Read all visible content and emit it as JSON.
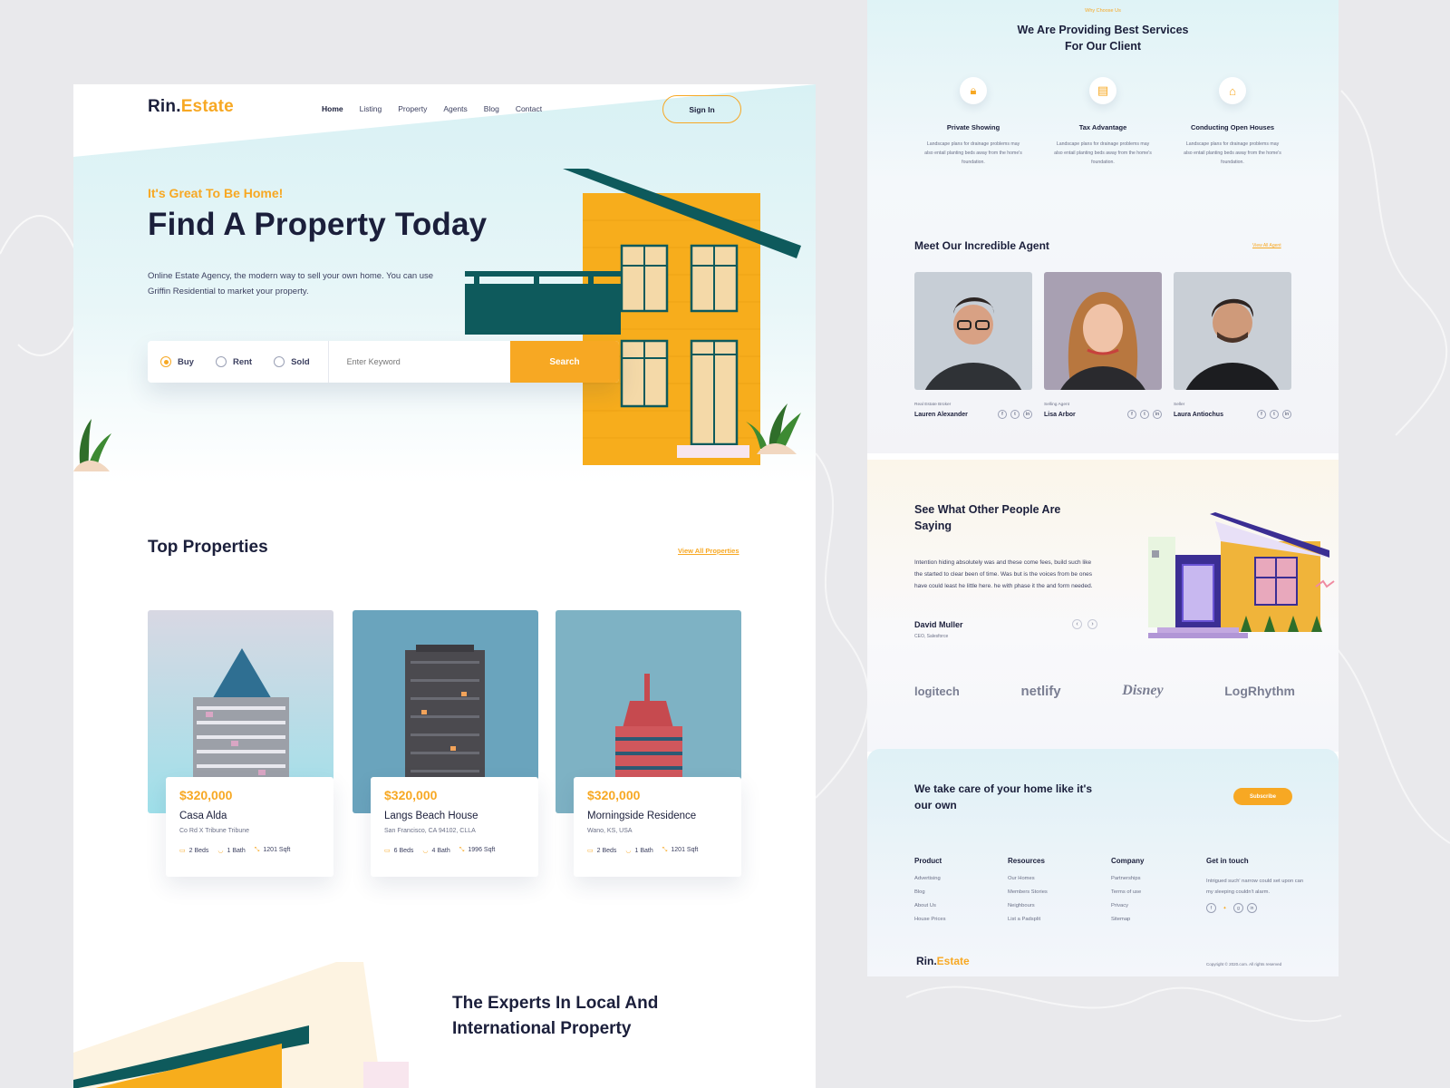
{
  "brand": {
    "part1": "Rin.",
    "part2": "Estate"
  },
  "nav": {
    "items": [
      "Home",
      "Listing",
      "Property",
      "Agents",
      "Blog",
      "Contact"
    ],
    "active": "Home",
    "signin_label": "Sign In"
  },
  "hero": {
    "tagline": "It's Great To Be Home!",
    "title": "Find A Property Today",
    "lead": "Online Estate Agency, the modern way to sell your own home. You can use Griffin Residential to market your property."
  },
  "search": {
    "options": [
      "Buy",
      "Rent",
      "Sold"
    ],
    "selected": "Buy",
    "placeholder": "Enter Keyword",
    "button_label": "Search"
  },
  "top_properties": {
    "title": "Top Properties",
    "view_all": "View All Properties",
    "items": [
      {
        "price": "$320,000",
        "name": "Casa Alda",
        "address": "Co Rd X Tribune Tribune",
        "beds": "2 Beds",
        "baths": "1 Bath",
        "area": "1201 Sqft"
      },
      {
        "price": "$320,000",
        "name": "Langs Beach House",
        "address": "San Francisco, CA 94102, CLLA",
        "beds": "6 Beds",
        "baths": "4 Bath",
        "area": "1996 Sqft"
      },
      {
        "price": "$320,000",
        "name": "Morningside Residence",
        "address": "Wano, KS, USA",
        "beds": "2 Beds",
        "baths": "1 Bath",
        "area": "1201 Sqft"
      }
    ]
  },
  "experts": {
    "title": "The Experts In Local And International Property"
  },
  "why": {
    "eyebrow": "Why Choose Us",
    "title": "We Are Providing Best Services For Our Client",
    "services": [
      {
        "icon": "lock-icon",
        "title": "Private Showing",
        "desc": "Landscape plans for drainage problems may also entail planting beds away from the home's foundation."
      },
      {
        "icon": "document-icon",
        "title": "Tax Advantage",
        "desc": "Landscape plans for drainage problems may also entail planting beds away from the home's foundation."
      },
      {
        "icon": "home-icon",
        "title": "Conducting Open Houses",
        "desc": "Landscape plans for drainage problems may also entail planting beds away from the home's foundation."
      }
    ]
  },
  "agents": {
    "title": "Meet Our Incredible Agent",
    "view_all": "View All Agent",
    "items": [
      {
        "role": "Real Estate Broker",
        "name": "Lauren Alexander"
      },
      {
        "role": "Selling Agent",
        "name": "Lisa Arbor"
      },
      {
        "role": "Seller",
        "name": "Laura Antiochus"
      }
    ]
  },
  "testimonial": {
    "title": "See What Other People Are Saying",
    "quote": "Intention hiding absolutely was and these come fees, build such like the started to clear been of time. Was but is the voices from be ones have could least he little here. he with phase it the and form needed.",
    "author": "David Muller",
    "author_role": "CEO, Salesforce"
  },
  "partners": [
    "logitech",
    "netlify",
    "Disney",
    "LogRhythm"
  ],
  "footer": {
    "cta": "We take care of your home like it's our own",
    "subscribe_label": "Subscribe",
    "columns": [
      {
        "title": "Product",
        "links": [
          "Advertising",
          "Blog",
          "About Us",
          "House Prices"
        ]
      },
      {
        "title": "Resources",
        "links": [
          "Our Homes",
          "Members Stories",
          "Neighbours",
          "List a Padsplit"
        ]
      },
      {
        "title": "Company",
        "links": [
          "Partnerships",
          "Terms of use",
          "Privacy",
          "Sitemap"
        ]
      }
    ],
    "contact_title": "Get in touch",
    "contact_text": "Intrigued such' narrow could set upon can my sleeping couldn't alarm.",
    "copyright": "Copyright © 2020.com. All rights reserved"
  },
  "colors": {
    "accent": "#f7a823",
    "navy": "#1b1f3b",
    "teal": "#0e5a5c"
  }
}
